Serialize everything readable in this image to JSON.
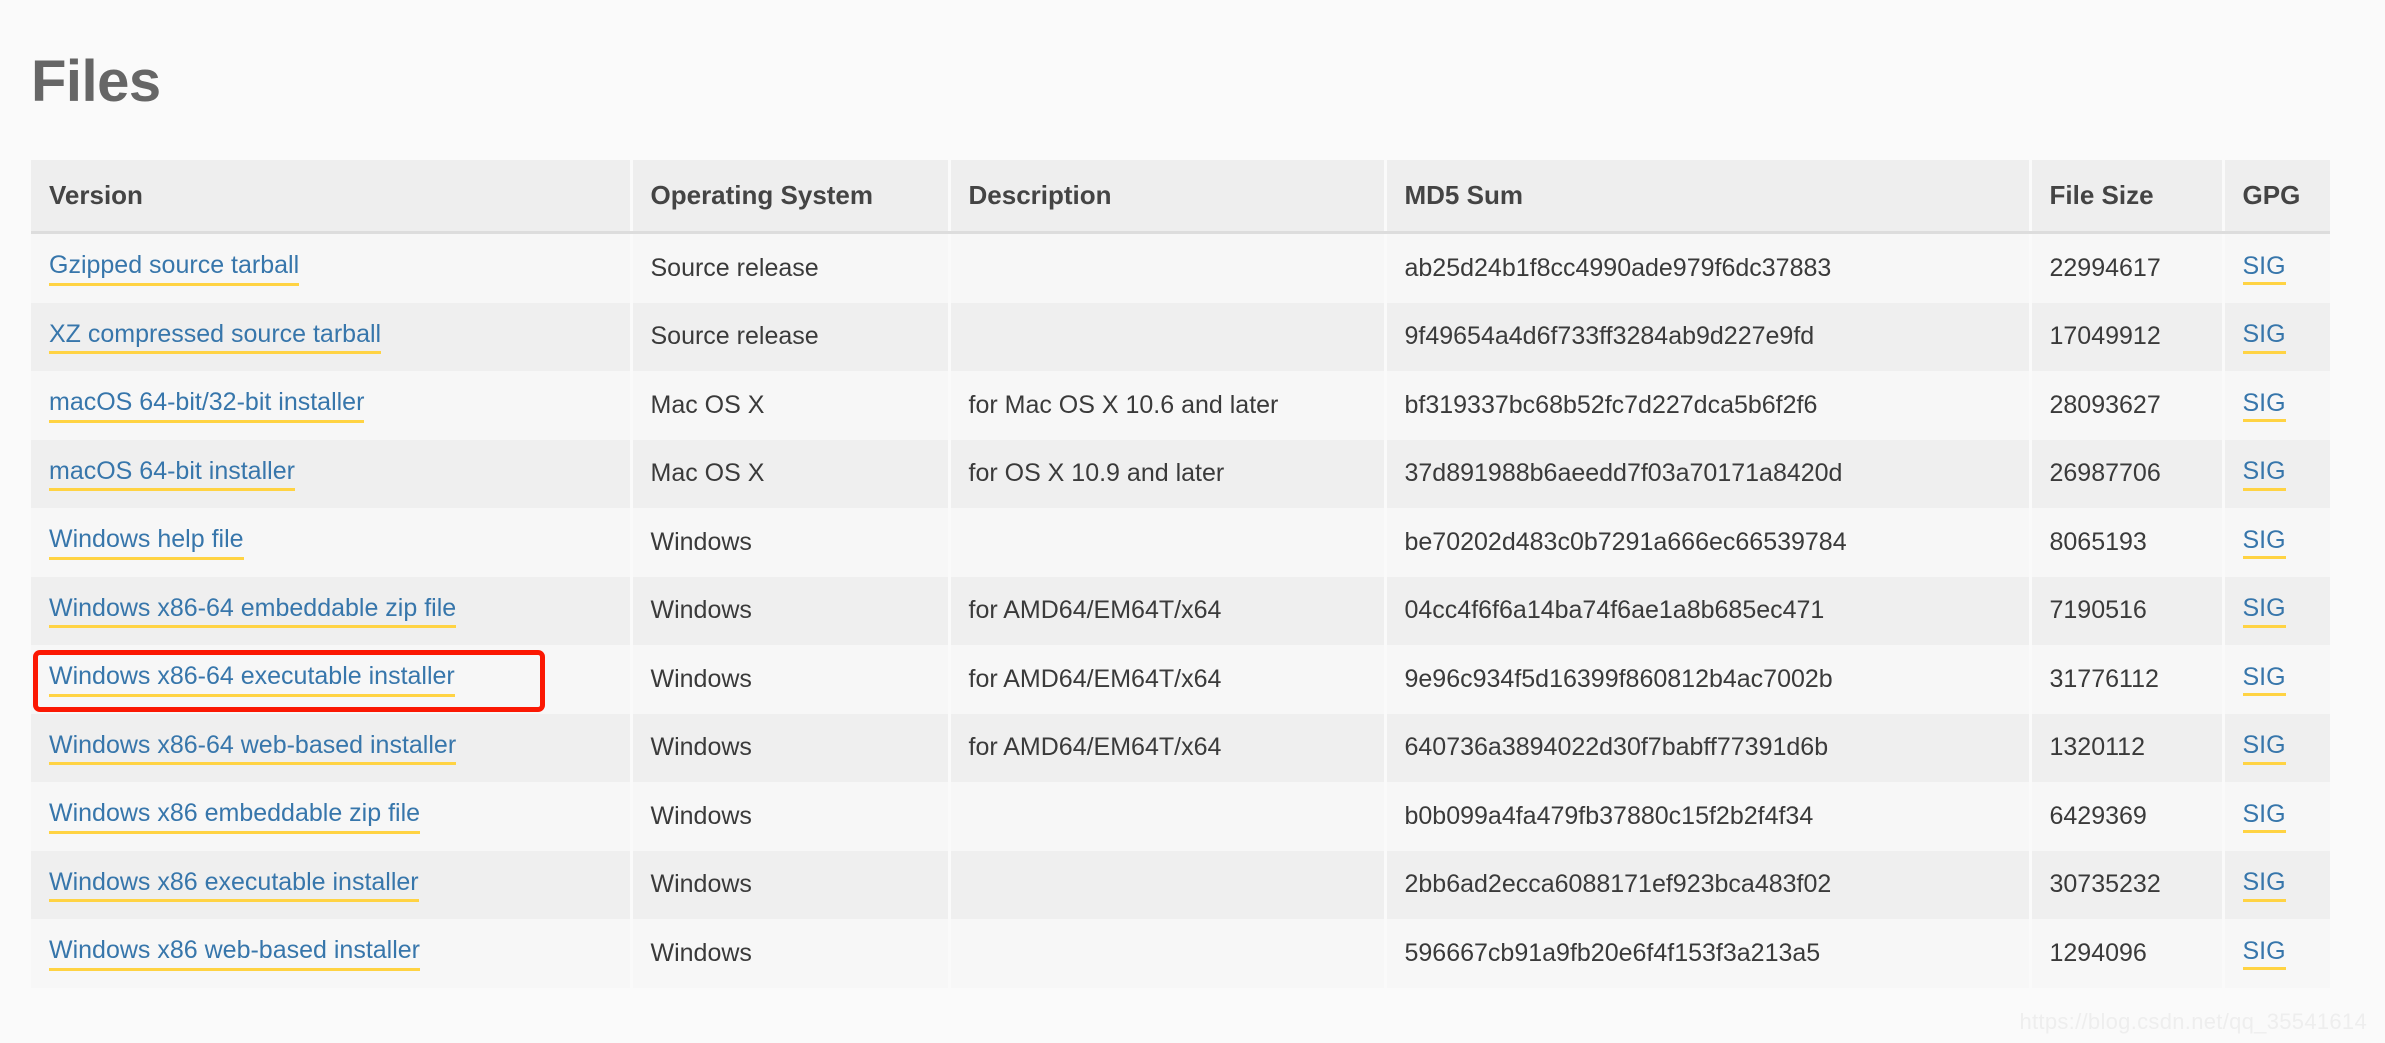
{
  "page": {
    "title": "Files",
    "watermark": "https://blog.csdn.net/qq_35541614"
  },
  "table": {
    "columns": [
      {
        "key": "version",
        "label": "Version"
      },
      {
        "key": "os",
        "label": "Operating System"
      },
      {
        "key": "description",
        "label": "Description"
      },
      {
        "key": "md5",
        "label": "MD5 Sum"
      },
      {
        "key": "filesize",
        "label": "File Size"
      },
      {
        "key": "gpg",
        "label": "GPG"
      }
    ],
    "gpg_link_label": "SIG",
    "rows": [
      {
        "version": "Gzipped source tarball",
        "os": "Source release",
        "description": "",
        "md5": "ab25d24b1f8cc4990ade979f6dc37883",
        "filesize": "22994617",
        "gpg": "SIG",
        "highlighted": false
      },
      {
        "version": "XZ compressed source tarball",
        "os": "Source release",
        "description": "",
        "md5": "9f49654a4d6f733ff3284ab9d227e9fd",
        "filesize": "17049912",
        "gpg": "SIG",
        "highlighted": false
      },
      {
        "version": "macOS 64-bit/32-bit installer",
        "os": "Mac OS X",
        "description": "for Mac OS X 10.6 and later",
        "md5": "bf319337bc68b52fc7d227dca5b6f2f6",
        "filesize": "28093627",
        "gpg": "SIG",
        "highlighted": false
      },
      {
        "version": "macOS 64-bit installer",
        "os": "Mac OS X",
        "description": "for OS X 10.9 and later",
        "md5": "37d891988b6aeedd7f03a70171a8420d",
        "filesize": "26987706",
        "gpg": "SIG",
        "highlighted": false
      },
      {
        "version": "Windows help file",
        "os": "Windows",
        "description": "",
        "md5": "be70202d483c0b7291a666ec66539784",
        "filesize": "8065193",
        "gpg": "SIG",
        "highlighted": false
      },
      {
        "version": "Windows x86-64 embeddable zip file",
        "os": "Windows",
        "description": "for AMD64/EM64T/x64",
        "md5": "04cc4f6f6a14ba74f6ae1a8b685ec471",
        "filesize": "7190516",
        "gpg": "SIG",
        "highlighted": false
      },
      {
        "version": "Windows x86-64 executable installer",
        "os": "Windows",
        "description": "for AMD64/EM64T/x64",
        "md5": "9e96c934f5d16399f860812b4ac7002b",
        "filesize": "31776112",
        "gpg": "SIG",
        "highlighted": true
      },
      {
        "version": "Windows x86-64 web-based installer",
        "os": "Windows",
        "description": "for AMD64/EM64T/x64",
        "md5": "640736a3894022d30f7babff77391d6b",
        "filesize": "1320112",
        "gpg": "SIG",
        "highlighted": false
      },
      {
        "version": "Windows x86 embeddable zip file",
        "os": "Windows",
        "description": "",
        "md5": "b0b099a4fa479fb37880c15f2b2f4f34",
        "filesize": "6429369",
        "gpg": "SIG",
        "highlighted": false
      },
      {
        "version": "Windows x86 executable installer",
        "os": "Windows",
        "description": "",
        "md5": "2bb6ad2ecca6088171ef923bca483f02",
        "filesize": "30735232",
        "gpg": "SIG",
        "highlighted": false
      },
      {
        "version": "Windows x86 web-based installer",
        "os": "Windows",
        "description": "",
        "md5": "596667cb91a9fb20e6f4f153f3a213a5",
        "filesize": "1294096",
        "gpg": "SIG",
        "highlighted": false
      }
    ]
  },
  "colors": {
    "link": "#3776ab",
    "link_underline": "#ffd343",
    "annotation": "#fb1803",
    "header_bg": "#eeeeee",
    "row_odd": "#f7f7f7",
    "row_even": "#efefef"
  }
}
